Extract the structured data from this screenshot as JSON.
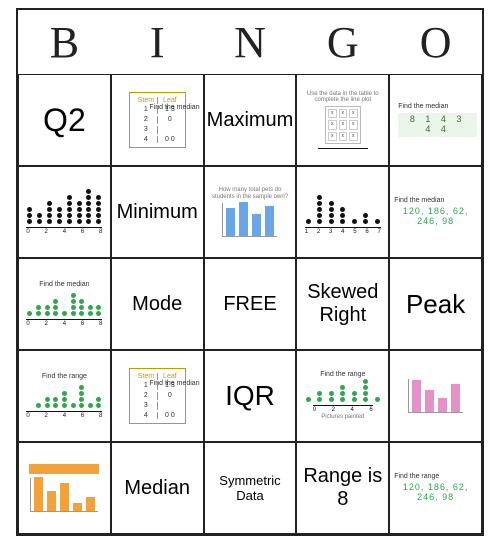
{
  "header": [
    "B",
    "I",
    "N",
    "G",
    "O"
  ],
  "cells": {
    "r0c0": "Q2",
    "r0c1_stemleaf": {
      "title": "Find the median",
      "stems": [
        1,
        2,
        3,
        4
      ],
      "leaves": [
        "1 3",
        "0",
        "",
        "0 0"
      ]
    },
    "r0c2": "Maximum",
    "r0c3_title": "Use the data in the table to complete the line plot",
    "r0c4_title": "Find the median",
    "r0c4_strip": "8 1 4 3 4 4",
    "r1c0_ticks": [
      "0",
      "2",
      "4",
      "6",
      "8"
    ],
    "r1c0_dots": [
      3,
      2,
      4,
      3,
      5,
      4,
      6,
      5
    ],
    "r1c1": "Minimum",
    "r1c2_title": "How many total pets do students in the sample own?",
    "r1c2_bars": [
      28,
      34,
      22,
      30
    ],
    "r1c3_ticks": [
      "1",
      "2",
      "3",
      "4",
      "5",
      "6",
      "7"
    ],
    "r1c3_dots": [
      1,
      5,
      4,
      3,
      1,
      2,
      1
    ],
    "r1c4_title": "Find the median",
    "r1c4_vals": "120, 186, 62, 246, 98",
    "r2c0_title": "Find the median",
    "r2c0_ticks": [
      "0",
      "2",
      "4",
      "6",
      "8"
    ],
    "r2c0_dots": [
      1,
      2,
      2,
      3,
      1,
      4,
      3,
      2,
      2
    ],
    "r2c1": "Mode",
    "r2c2": "FREE",
    "r2c3": "Skewed Right",
    "r2c4": "Peak",
    "r3c0_title": "Find the range",
    "r3c0_ticks": [
      "0",
      "2",
      "4",
      "6",
      "8"
    ],
    "r3c0_dots": [
      0,
      1,
      2,
      2,
      3,
      1,
      4,
      1,
      2
    ],
    "r3c1_stemleaf": {
      "title": "Find the median",
      "stems": [
        1,
        2,
        3,
        4
      ],
      "leaves": [
        "1 3",
        "0",
        "",
        "0 0"
      ]
    },
    "r3c2": "IQR",
    "r3c3_title": "Find the range",
    "r3c3_sub": "Pictures painted",
    "r3c3_ticks": [
      "0",
      "2",
      "4",
      "6"
    ],
    "r3c3_dots": [
      1,
      2,
      2,
      3,
      2,
      4,
      1
    ],
    "r3c4_title": "",
    "r3c4_bars": [
      32,
      22,
      14,
      28
    ],
    "r4c0_bars": [
      34,
      20,
      28,
      8,
      14
    ],
    "r4c1": "Median",
    "r4c2": "Symmetric Data",
    "r4c3": "Range is 8",
    "r4c4_title": "Find the range",
    "r4c4_vals": "120, 186, 62, 246, 98"
  }
}
